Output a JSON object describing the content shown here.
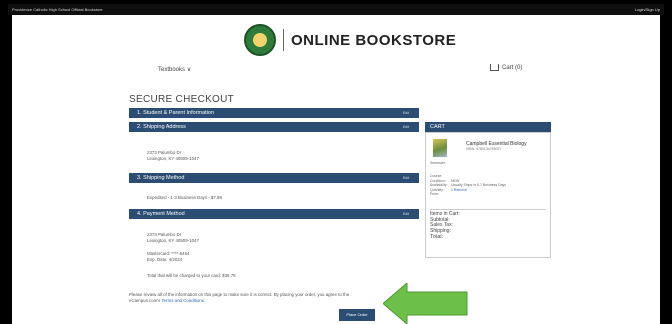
{
  "topbar": {
    "school_name": "Providence Catholic High School Official Bookstore",
    "login": "Login/Sign Up"
  },
  "header": {
    "logo_text": "ONLINE BOOKSTORE",
    "nav_textbooks": "Textbooks",
    "cart_label": "Cart (0)"
  },
  "checkout": {
    "title": "SECURE CHECKOUT",
    "edit_label": "Edit",
    "sections": [
      {
        "label": "1. Student & Parent Information"
      },
      {
        "label": "2. Shipping Address"
      },
      {
        "label": "3. Shipping Method"
      },
      {
        "label": "4. Payment Method"
      }
    ],
    "shipping_address": [
      "2373 Palumbo Dr",
      "Lexington, KY 40509-1047"
    ],
    "shipping_method": "Expedited - 1-3 Business Days - $7.99",
    "billing_address": [
      "2373 Palumbo Dr",
      "Lexington, KY 40509-1047"
    ],
    "card": [
      "Mastercard: ****-5454",
      "Exp. Date: 4/2024"
    ],
    "total_charged": "Total that will be charged to your card: $35.76",
    "review_line1": "Please review all of the information on this page to make sure it is correct. By placing your order, you agree to the",
    "review_line2_prefix": "eCampus.com's ",
    "review_link": "Terms and Conditions",
    "review_suffix": ".",
    "place_order": "Place Order"
  },
  "cart": {
    "heading": "CART",
    "book_title": "Campbell Essential Biology",
    "isbn": "ISBN: 9780134765037",
    "semester_label": "Semester:",
    "meta_labels": [
      "Course:",
      "Condition:",
      "Availability:",
      "Quantity:",
      "Price:"
    ],
    "meta_values": [
      "NEW",
      "Usually Ships in 5-7 Business Days",
      "1 Remove"
    ],
    "totals": [
      "Items in Cart:",
      "Subtotal:",
      "Sales Tax:",
      "Shipping:",
      "Total:"
    ]
  },
  "colors": {
    "section_bar": "#2b4d73",
    "arrow": "#6cc04a",
    "link": "#2a66b5"
  }
}
